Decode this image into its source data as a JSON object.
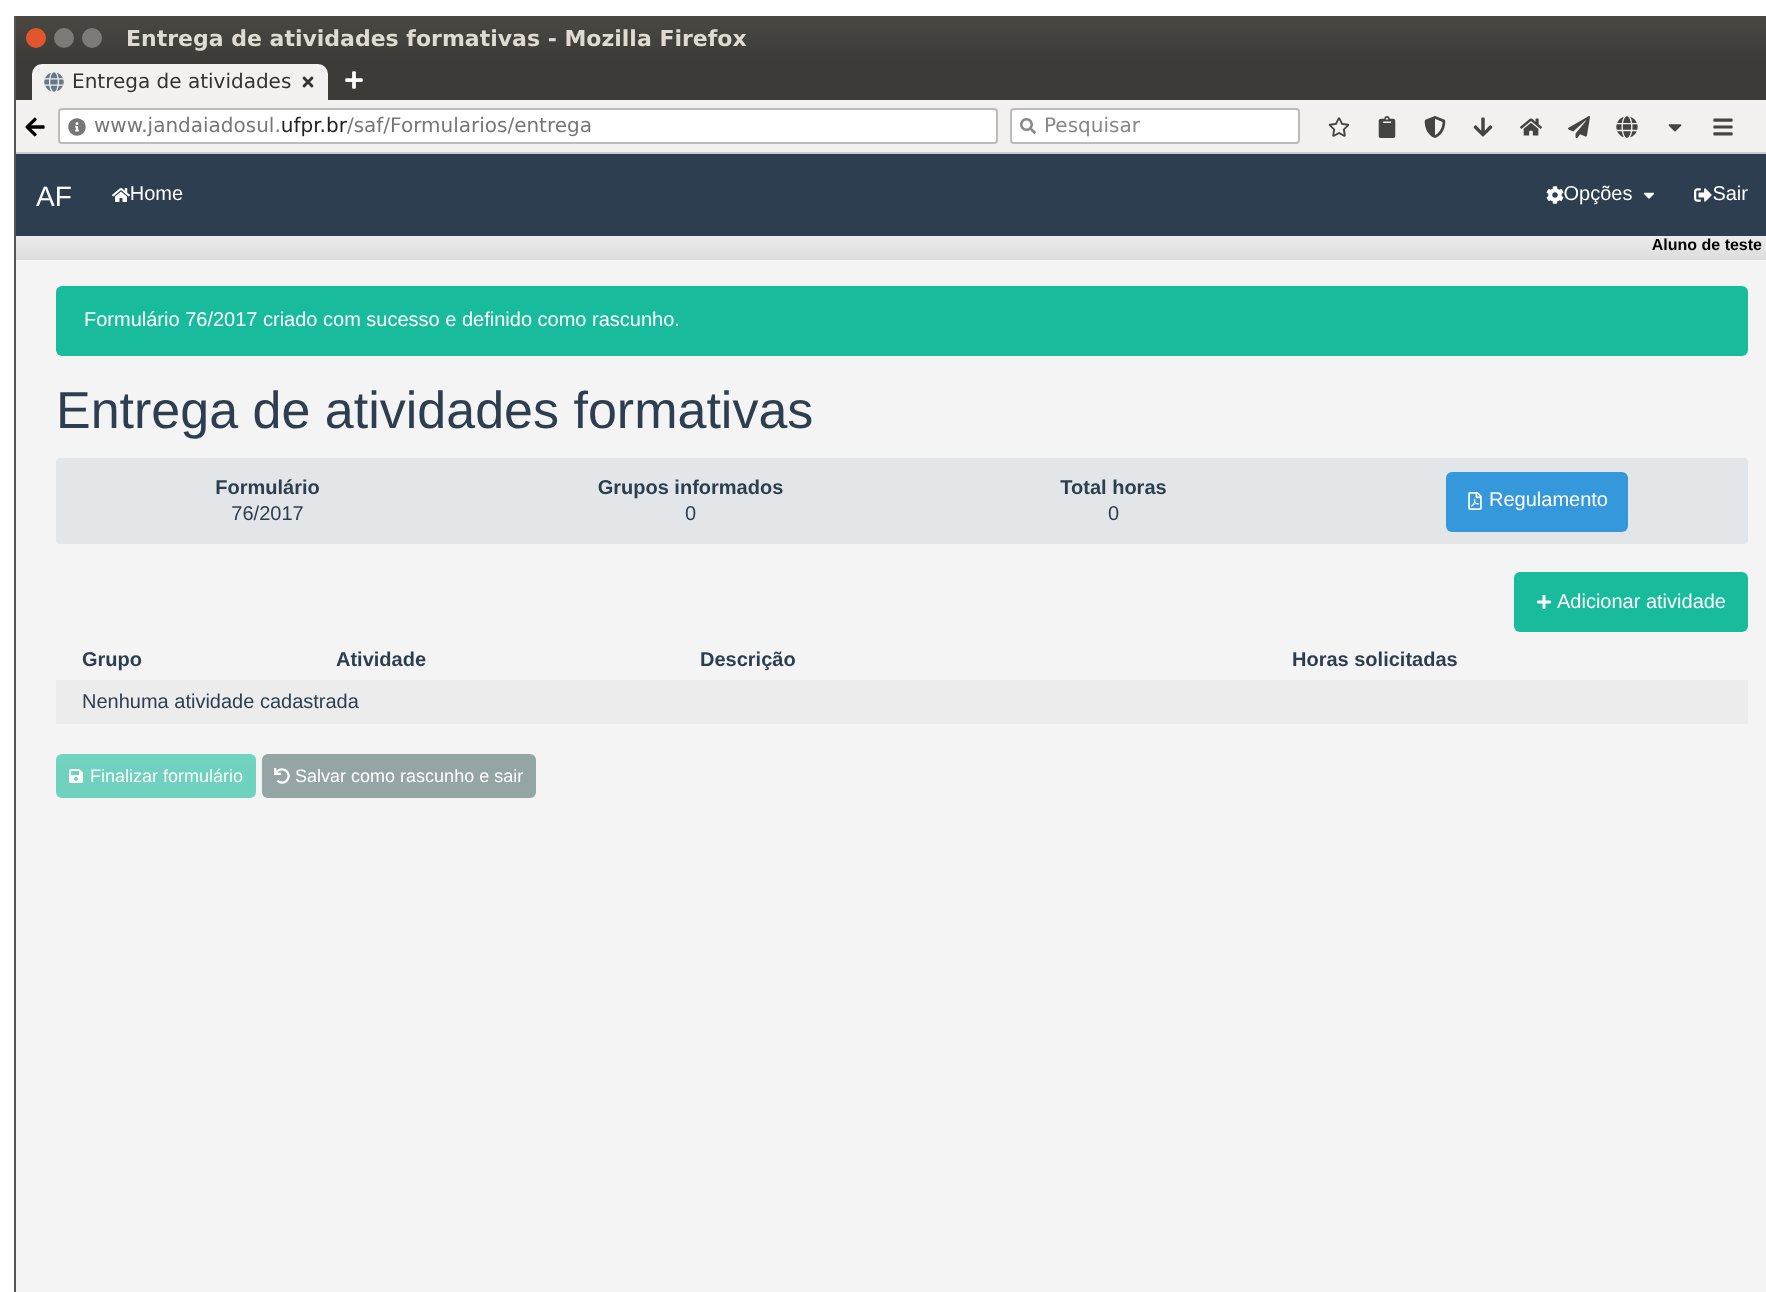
{
  "window": {
    "title": "Entrega de atividades formativas - Mozilla Firefox"
  },
  "tabs": [
    {
      "label": "Entrega de atividades",
      "selected": true
    }
  ],
  "address_bar": {
    "prefix": "www.jandaiadosul.",
    "domain": "ufpr.br",
    "path": "/saf/Formularios/entrega"
  },
  "search": {
    "placeholder": "Pesquisar"
  },
  "navbar": {
    "brand": "AF",
    "home": "Home",
    "options": "Opções",
    "logout": "Sair",
    "user": "Aluno de teste"
  },
  "alert": "Formulário 76/2017 criado com sucesso e definido como rascunho.",
  "heading": "Entrega de atividades formativas",
  "summary": [
    {
      "label": "Formulário",
      "value": "76/2017"
    },
    {
      "label": "Grupos informados",
      "value": "0"
    },
    {
      "label": "Total horas",
      "value": "0"
    }
  ],
  "regulamento_button": "Regulamento",
  "add_button": "Adicionar atividade",
  "table": {
    "columns": [
      "Grupo",
      "Atividade",
      "Descrição",
      "Horas solicitadas"
    ],
    "empty": "Nenhuma atividade cadastrada"
  },
  "actions": [
    {
      "label": "Finalizar formulário",
      "kind": "save",
      "disabled": true
    },
    {
      "label": "Salvar como rascunho e sair",
      "kind": "undo",
      "disabled": false
    }
  ]
}
